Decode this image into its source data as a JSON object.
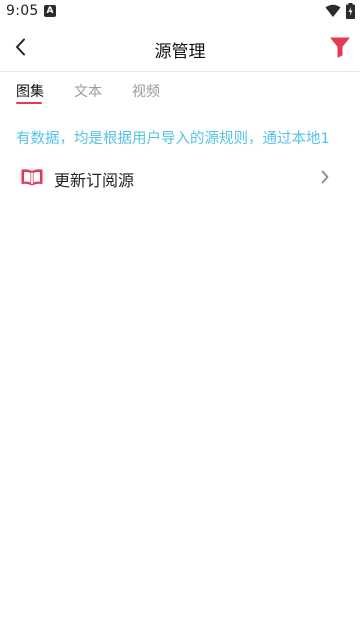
{
  "status_bar": {
    "time": "9:05",
    "notification_icon": "a-notification-icon",
    "wifi_icon": "wifi-icon",
    "battery_icon": "battery-icon"
  },
  "header": {
    "title": "源管理",
    "back_icon": "chevron-left-icon",
    "filter_icon": "filter-icon",
    "accent_color": "#e53950"
  },
  "tabs": [
    {
      "label": "图集",
      "active": true
    },
    {
      "label": "文本",
      "active": false
    },
    {
      "label": "视频",
      "active": false
    }
  ],
  "notice": {
    "text": "有数据，均是根据用户导入的源规则，通过本地1",
    "color": "#55c3e6"
  },
  "list": [
    {
      "icon": "open-book-icon",
      "label": "更新订阅源",
      "trailing_icon": "chevron-right-icon"
    }
  ]
}
